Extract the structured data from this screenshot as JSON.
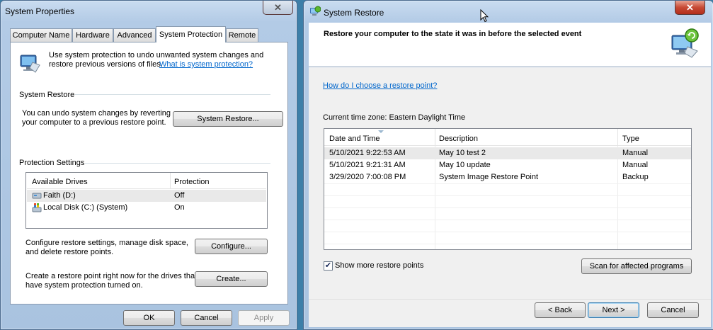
{
  "system_properties": {
    "title": "System Properties",
    "close_glyph": "✕",
    "tabs": [
      "Computer Name",
      "Hardware",
      "Advanced",
      "System Protection",
      "Remote"
    ],
    "selected_tab": "System Protection",
    "intro_line1": "Use system protection to undo unwanted system changes and",
    "intro_line2": "restore previous versions of files.",
    "intro_link": "What is system protection?",
    "restore_group": {
      "heading": "System Restore",
      "desc_line1": "You can undo system changes by reverting",
      "desc_line2": "your computer to a previous restore point.",
      "button": "System Restore..."
    },
    "protection_group": {
      "heading": "Protection Settings",
      "columns": [
        "Available Drives",
        "Protection"
      ],
      "drives": [
        {
          "name": "Faith (D:)",
          "protection": "Off",
          "icon": "drive-icon"
        },
        {
          "name": "Local Disk (C:) (System)",
          "protection": "On",
          "icon": "windows-drive-icon"
        }
      ]
    },
    "configure": {
      "line1": "Configure restore settings, manage disk space,",
      "line2": "and delete restore points.",
      "button": "Configure..."
    },
    "create": {
      "line1": "Create a restore point right now for the drives that",
      "line2": "have system protection turned on.",
      "button": "Create..."
    },
    "footer": {
      "ok": "OK",
      "cancel": "Cancel",
      "apply": "Apply"
    }
  },
  "system_restore": {
    "title": "System Restore",
    "close_glyph": "✕",
    "heading": "Restore your computer to the state it was in before the selected event",
    "help_link": "How do I choose a restore point?",
    "timezone": "Current time zone: Eastern Daylight Time",
    "columns": [
      "Date and Time",
      "Description",
      "Type"
    ],
    "restore_points": [
      {
        "date": "5/10/2021 9:22:53 AM",
        "description": "May 10 test 2",
        "type": "Manual"
      },
      {
        "date": "5/10/2021 9:21:31 AM",
        "description": "May 10 update",
        "type": "Manual"
      },
      {
        "date": "3/29/2020 7:00:08 PM",
        "description": "System Image Restore Point",
        "type": "Backup"
      }
    ],
    "show_more_label": "Show more restore points",
    "show_more_checked": true,
    "check_glyph": "✔",
    "scan_button": "Scan for affected programs",
    "footer": {
      "back": "< Back",
      "next": "Next >",
      "cancel": "Cancel"
    }
  },
  "colors": {
    "link": "#0066cc",
    "close_active": "#c74a35",
    "selection": "#e9e9e9"
  }
}
